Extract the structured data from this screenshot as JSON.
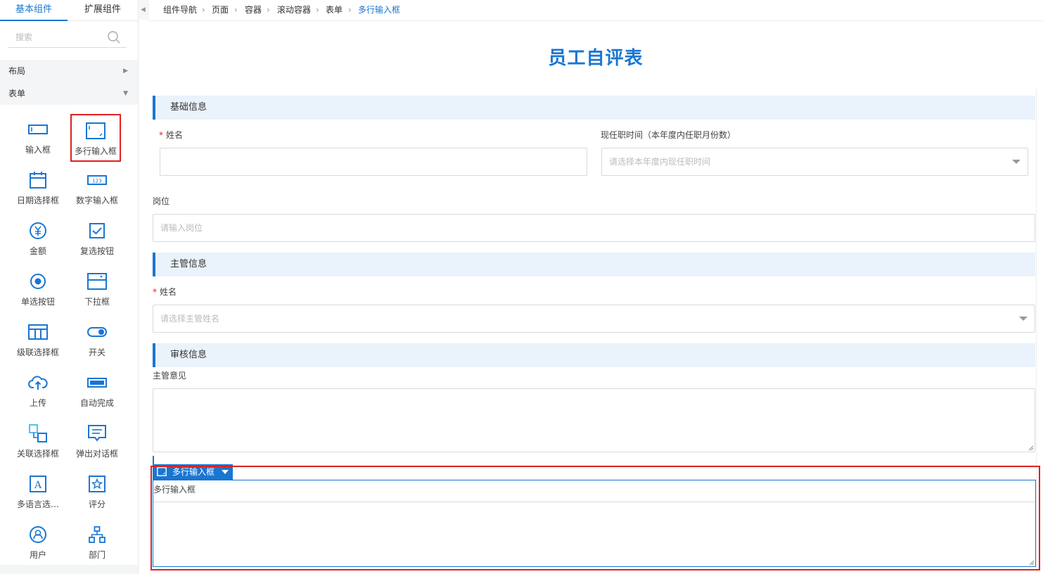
{
  "sidebar": {
    "tabs": [
      {
        "label": "基本组件",
        "active": true
      },
      {
        "label": "扩展组件",
        "active": false
      }
    ],
    "search_placeholder": "搜索",
    "groups": [
      {
        "label": "布局",
        "expanded": false
      },
      {
        "label": "表单",
        "expanded": true
      }
    ],
    "items": [
      {
        "label": "输入框",
        "icon": "input-box-icon"
      },
      {
        "label": "多行输入框",
        "icon": "textarea-icon",
        "selected": true
      },
      {
        "label": "日期选择框",
        "icon": "calendar-icon"
      },
      {
        "label": "数字输入框",
        "icon": "number-123-icon"
      },
      {
        "label": "金额",
        "icon": "yen-icon"
      },
      {
        "label": "复选按钮",
        "icon": "checkbox-icon"
      },
      {
        "label": "单选按钮",
        "icon": "radio-icon"
      },
      {
        "label": "下拉框",
        "icon": "dropdown-icon"
      },
      {
        "label": "级联选择框",
        "icon": "cascader-icon"
      },
      {
        "label": "开关",
        "icon": "switch-icon"
      },
      {
        "label": "上传",
        "icon": "cloud-upload-icon"
      },
      {
        "label": "自动完成",
        "icon": "autocomplete-icon"
      },
      {
        "label": "关联选择框",
        "icon": "relation-icon"
      },
      {
        "label": "弹出对话框",
        "icon": "dialog-icon"
      },
      {
        "label": "多语言选…",
        "icon": "letter-a-icon"
      },
      {
        "label": "评分",
        "icon": "star-icon"
      },
      {
        "label": "用户",
        "icon": "user-icon"
      },
      {
        "label": "部门",
        "icon": "org-icon"
      }
    ]
  },
  "breadcrumb": [
    "组件导航",
    "页面",
    "容器",
    "滚动容器",
    "表单",
    "多行输入框"
  ],
  "form": {
    "title": "员工自评表",
    "sections": [
      {
        "title": "基础信息"
      },
      {
        "title": "主管信息"
      },
      {
        "title": "审核信息"
      }
    ],
    "fields": {
      "name": {
        "label": "姓名",
        "required": true,
        "value": ""
      },
      "tenure": {
        "label": "现任职时间（本年度内任职月份数）",
        "placeholder": "请选择本年度内现任职时间"
      },
      "position": {
        "label": "岗位",
        "placeholder": "请输入岗位"
      },
      "manager_name": {
        "label": "姓名",
        "required": true,
        "placeholder": "请选择主管姓名"
      },
      "manager_opinion": {
        "label": "主管意见",
        "value": ""
      }
    },
    "selected_component": {
      "tag_label": "多行输入框",
      "field_label": "多行输入框"
    }
  },
  "colors": {
    "accent": "#1976d2",
    "required": "#e02020",
    "selection_outline": "#e02020",
    "section_bg": "#eaf2fb"
  }
}
